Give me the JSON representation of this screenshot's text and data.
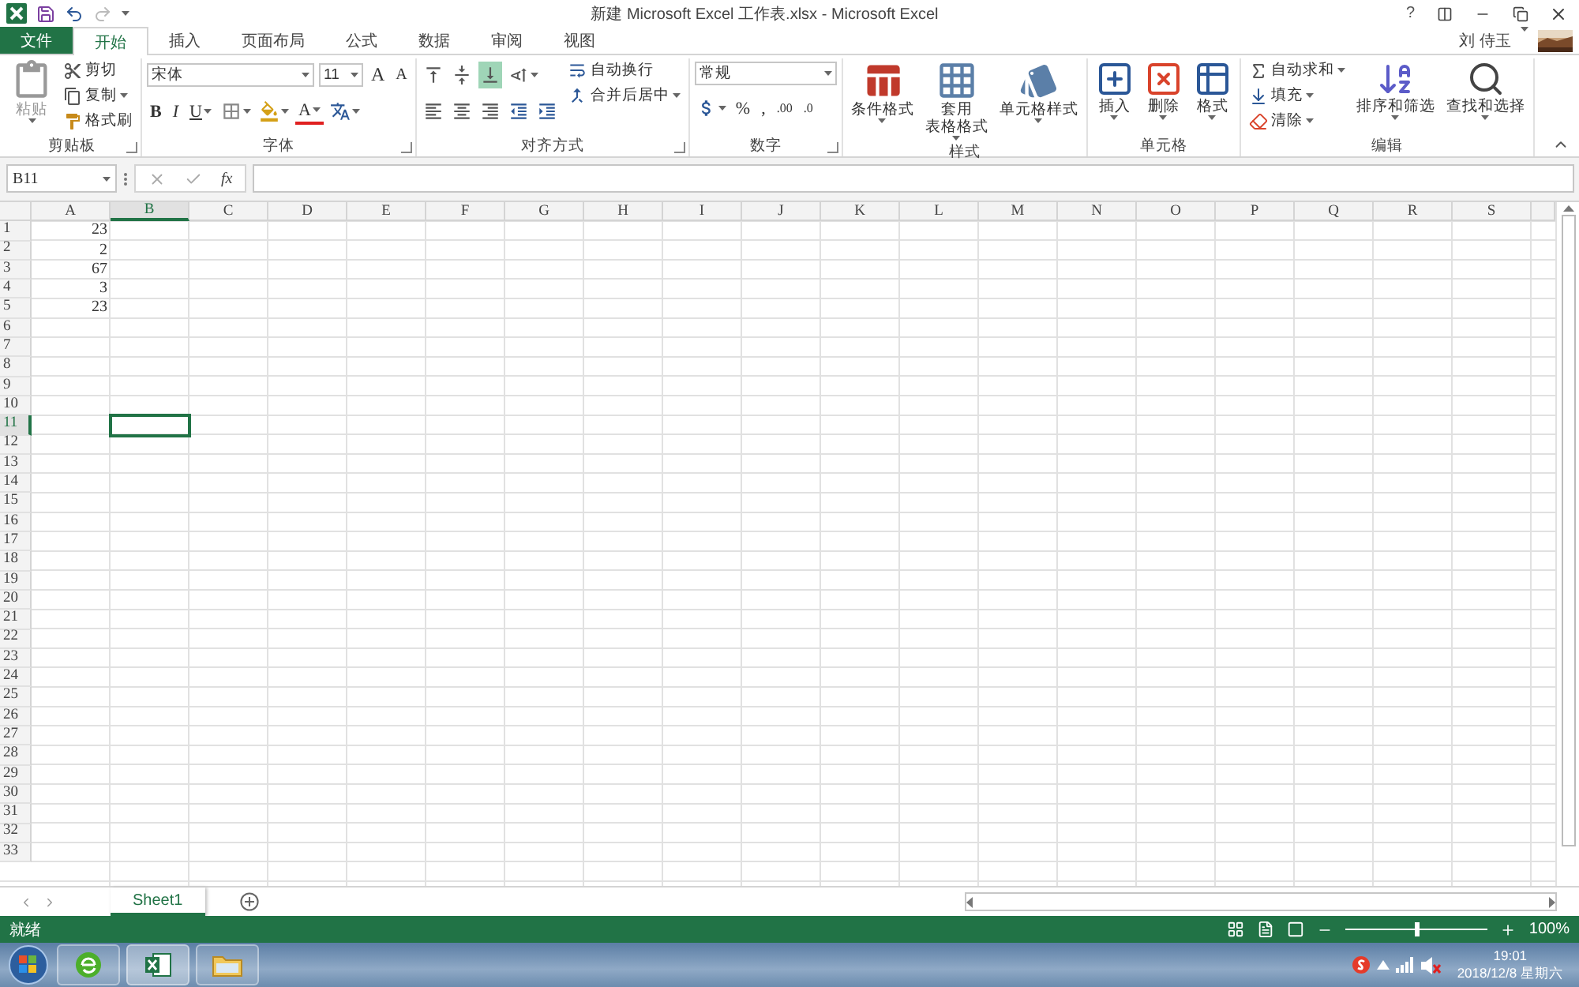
{
  "window": {
    "title": "新建 Microsoft Excel 工作表.xlsx - Microsoft Excel",
    "help": "?"
  },
  "user": {
    "name": "刘 侍玉"
  },
  "tabs": [
    {
      "label": "文件",
      "kind": "file",
      "selected": false
    },
    {
      "label": "开始",
      "kind": "tab",
      "selected": true
    },
    {
      "label": "插入",
      "kind": "tab",
      "selected": false
    },
    {
      "label": "页面布局",
      "kind": "tab",
      "selected": false
    },
    {
      "label": "公式",
      "kind": "tab",
      "selected": false
    },
    {
      "label": "数据",
      "kind": "tab",
      "selected": false
    },
    {
      "label": "审阅",
      "kind": "tab",
      "selected": false
    },
    {
      "label": "视图",
      "kind": "tab",
      "selected": false
    }
  ],
  "ribbon_groups": [
    {
      "title": "剪贴板",
      "launcher": true,
      "blocks": [
        {
          "kind": "large",
          "label": "粘贴",
          "disabled": true,
          "dropdown": true
        },
        {
          "kind": "stack",
          "items": [
            {
              "label": "剪切",
              "dropdown": false
            },
            {
              "label": "复制",
              "dropdown": true
            },
            {
              "label": "格式刷",
              "dropdown": false
            }
          ]
        }
      ]
    },
    {
      "title": "字体",
      "launcher": true,
      "blocks": [
        {
          "kind": "toolbar",
          "lines": [
            [
              {
                "kind": "combo-wide",
                "value": "宋体"
              },
              {
                "kind": "combo-narrow",
                "value": "11"
              },
              {
                "kind": "grow-glyph",
                "label": "A"
              },
              {
                "kind": "shrink-glyph",
                "label": "A"
              }
            ],
            [
              {
                "kind": "bold-glyph",
                "label": "B"
              },
              {
                "kind": "italic-glyph",
                "label": "I"
              },
              {
                "kind": "underline-glyph",
                "label": "U",
                "dropdown": true
              },
              {
                "kind": "icon",
                "dropdown": true
              },
              {
                "kind": "icon",
                "dropdown": true
              },
              {
                "kind": "color-glyph",
                "label": "A",
                "dropdown": true
              },
              {
                "kind": "icon",
                "dropdown": true
              }
            ]
          ]
        }
      ]
    },
    {
      "title": "对齐方式",
      "launcher": true,
      "blocks": [
        {
          "kind": "toolbar",
          "lines": [
            [
              {
                "kind": "icon",
                "selected": false
              },
              {
                "kind": "icon",
                "selected": false
              },
              {
                "kind": "icon",
                "selected": true
              },
              {
                "kind": "icon",
                "dropdown": true
              }
            ],
            [
              {
                "kind": "icon"
              },
              {
                "kind": "icon"
              },
              {
                "kind": "icon"
              },
              {
                "kind": "icon"
              },
              {
                "kind": "icon"
              }
            ]
          ]
        },
        {
          "kind": "stack",
          "items": [
            {
              "label": "自动换行",
              "dropdown": false
            },
            {
              "label": "合并后居中",
              "dropdown": true
            }
          ]
        }
      ]
    },
    {
      "title": "数字",
      "launcher": true,
      "blocks": [
        {
          "kind": "toolbar",
          "lines": [
            [
              {
                "kind": "combo-number",
                "value": "常规"
              }
            ],
            [
              {
                "kind": "icon",
                "dropdown": true
              },
              {
                "kind": "plain-glyph",
                "label": "%"
              },
              {
                "kind": "plain-glyph",
                "label": ","
              },
              {
                "kind": "decimal-glyph",
                "label": ".00"
              },
              {
                "kind": "decimal-glyph",
                "label": ".0"
              }
            ]
          ]
        }
      ]
    },
    {
      "title": "样式",
      "launcher": false,
      "blocks": [
        {
          "kind": "large",
          "label": "条件格式",
          "dropdown": true
        },
        {
          "kind": "large",
          "lines": [
            "套用",
            "表格格式"
          ],
          "dropdown": true
        },
        {
          "kind": "large",
          "label": "单元格样式",
          "dropdown": true
        }
      ]
    },
    {
      "title": "单元格",
      "launcher": false,
      "blocks": [
        {
          "kind": "large",
          "label": "插入",
          "dropdown": true
        },
        {
          "kind": "large",
          "label": "删除",
          "dropdown": true
        },
        {
          "kind": "large",
          "label": "格式",
          "dropdown": true
        }
      ]
    },
    {
      "title": "编辑",
      "launcher": false,
      "blocks": [
        {
          "kind": "stack",
          "items": [
            {
              "label": "自动求和",
              "dropdown": true
            },
            {
              "label": "填充",
              "dropdown": true
            },
            {
              "label": "清除",
              "dropdown": true
            }
          ]
        },
        {
          "kind": "large",
          "label": "排序和筛选",
          "dropdown": true
        },
        {
          "kind": "large",
          "label": "查找和选择",
          "dropdown": true
        }
      ]
    }
  ],
  "formula_bar": {
    "name_box": "B11",
    "function_label": "fx"
  },
  "columns": [
    {
      "label": "A",
      "selected": false
    },
    {
      "label": "B",
      "selected": true
    },
    {
      "label": "C",
      "selected": false
    },
    {
      "label": "D",
      "selected": false
    },
    {
      "label": "E",
      "selected": false
    },
    {
      "label": "F",
      "selected": false
    },
    {
      "label": "G",
      "selected": false
    },
    {
      "label": "H",
      "selected": false
    },
    {
      "label": "I",
      "selected": false
    },
    {
      "label": "J",
      "selected": false
    },
    {
      "label": "K",
      "selected": false
    },
    {
      "label": "L",
      "selected": false
    },
    {
      "label": "M",
      "selected": false
    },
    {
      "label": "N",
      "selected": false
    },
    {
      "label": "O",
      "selected": false
    },
    {
      "label": "P",
      "selected": false
    },
    {
      "label": "Q",
      "selected": false
    },
    {
      "label": "R",
      "selected": false
    },
    {
      "label": "S",
      "selected": false
    }
  ],
  "rows": [
    {
      "label": "1",
      "selected": false,
      "cells": [
        "23"
      ]
    },
    {
      "label": "2",
      "selected": false,
      "cells": [
        "2"
      ]
    },
    {
      "label": "3",
      "selected": false,
      "cells": [
        "67"
      ]
    },
    {
      "label": "4",
      "selected": false,
      "cells": [
        "3"
      ]
    },
    {
      "label": "5",
      "selected": false,
      "cells": [
        "23"
      ]
    },
    {
      "label": "6",
      "selected": false
    },
    {
      "label": "7",
      "selected": false
    },
    {
      "label": "8",
      "selected": false
    },
    {
      "label": "9",
      "selected": false
    },
    {
      "label": "10",
      "selected": false
    },
    {
      "label": "11",
      "selected": true
    },
    {
      "label": "12",
      "selected": false
    },
    {
      "label": "13",
      "selected": false
    },
    {
      "label": "14",
      "selected": false
    },
    {
      "label": "15",
      "selected": false
    },
    {
      "label": "16",
      "selected": false
    },
    {
      "label": "17",
      "selected": false
    },
    {
      "label": "18",
      "selected": false
    },
    {
      "label": "19",
      "selected": false
    },
    {
      "label": "20",
      "selected": false
    },
    {
      "label": "21",
      "selected": false
    },
    {
      "label": "22",
      "selected": false
    },
    {
      "label": "23",
      "selected": false
    },
    {
      "label": "24",
      "selected": false
    },
    {
      "label": "25",
      "selected": false
    },
    {
      "label": "26",
      "selected": false
    },
    {
      "label": "27",
      "selected": false
    },
    {
      "label": "28",
      "selected": false
    },
    {
      "label": "29",
      "selected": false
    },
    {
      "label": "30",
      "selected": false
    },
    {
      "label": "31",
      "selected": false
    },
    {
      "label": "32",
      "selected": false
    },
    {
      "label": "33",
      "selected": false
    }
  ],
  "sheet_tabs": [
    {
      "label": "Sheet1",
      "selected": true
    }
  ],
  "status_bar": {
    "status": "就绪",
    "zoom": "100%",
    "zoom_slider": {
      "level": 0.5
    }
  },
  "taskbar": {
    "time": "19:01",
    "date": "2018/12/8 星期六"
  }
}
